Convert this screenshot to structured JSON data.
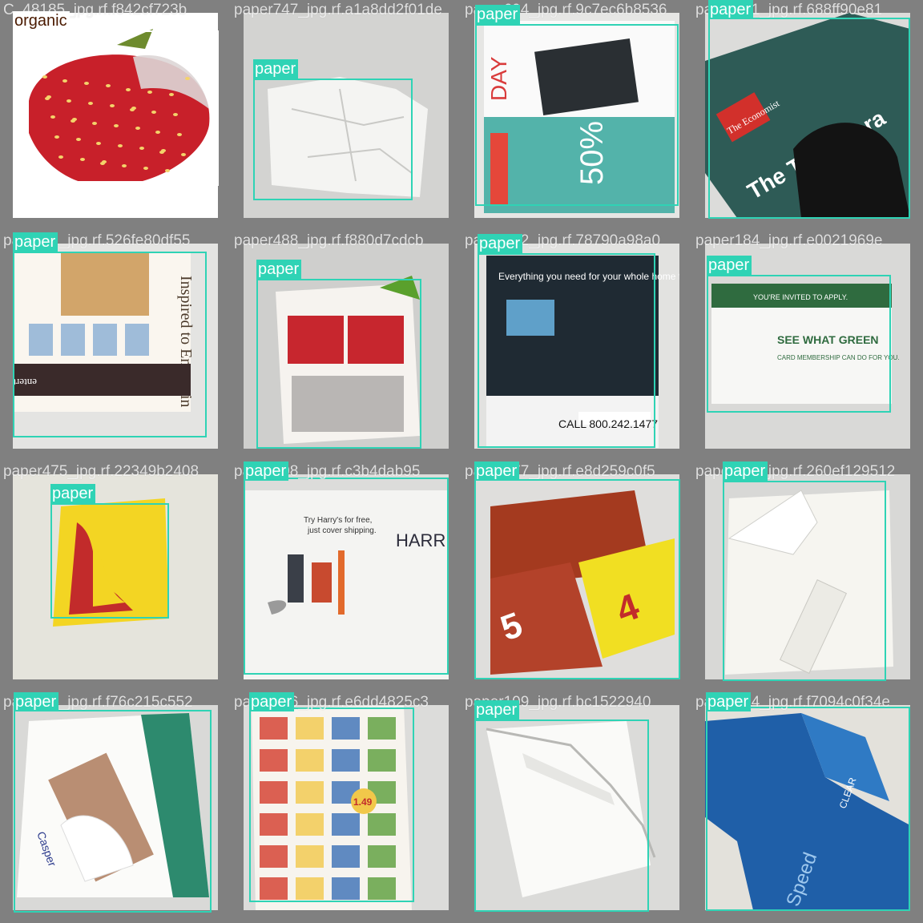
{
  "title": "",
  "label_colors": {
    "paper": "#2fd3b5",
    "organic": "#ffffff",
    "organic_text": "#4a1a00"
  },
  "tiles": [
    {
      "row": 0,
      "col": 0,
      "class": "organic",
      "label": "organic",
      "filenames": [
        "C_48185_jpg.rf.f842cf723b"
      ],
      "photo": "strawberry"
    },
    {
      "row": 0,
      "col": 1,
      "class": "paper",
      "label": "paper",
      "filenames": [
        "paper747_jpg.rf.a1a8dd2f01de"
      ],
      "photo": "crumpled-white"
    },
    {
      "row": 0,
      "col": 2,
      "class": "paper",
      "label": "paper",
      "filenames": [
        "paper694_jpg.rf.9c7ec6b8536"
      ],
      "photo": "dell-flyer"
    },
    {
      "row": 0,
      "col": 3,
      "class": "paper",
      "label": "paper",
      "filenames": [
        "paper431_jpg.rf.688ff90e81"
      ],
      "photo": "economist"
    },
    {
      "row": 1,
      "col": 0,
      "class": "paper",
      "label": "paper",
      "filenames": [
        "paper81_jpg.rf.526fe80df55"
      ],
      "photo": "entertain-ad"
    },
    {
      "row": 1,
      "col": 1,
      "class": "paper",
      "label": "paper",
      "filenames": [
        "paper488_jpg.rf.f880d7cdcb"
      ],
      "photo": "coupon-flyer"
    },
    {
      "row": 1,
      "col": 2,
      "class": "paper",
      "label": "paper",
      "filenames": [
        "paper172_jpg.rf.78790a98a0"
      ],
      "photo": "att-flyer"
    },
    {
      "row": 1,
      "col": 3,
      "class": "paper",
      "label": "paper",
      "filenames": [
        "paper184_jpg.rf.e0021969e"
      ],
      "photo": "green-envelope"
    },
    {
      "row": 2,
      "col": 0,
      "class": "paper",
      "label": "paper",
      "filenames": [
        "paper475_jpg.rf.22349b2408"
      ],
      "photo": "yellow-card"
    },
    {
      "row": 2,
      "col": 1,
      "class": "paper",
      "label": "paper",
      "filenames": [
        "paper108_jpg.rf.c3b4dab95"
      ],
      "photo": "harrys-mailer"
    },
    {
      "row": 2,
      "col": 2,
      "class": "paper",
      "label": "paper",
      "filenames": [
        "paper277_jpg.rf.e8d259c0f5"
      ],
      "photo": "pizza-flyer"
    },
    {
      "row": 2,
      "col": 3,
      "class": "paper",
      "label": "paper",
      "filenames": [
        "paper205_jpg.rf.260ef129512"
      ],
      "photo": "torn-envelope"
    },
    {
      "row": 3,
      "col": 0,
      "class": "paper",
      "label": "paper",
      "filenames": [
        "paper54_jpg.rf.f76c215c552"
      ],
      "photo": "catalog"
    },
    {
      "row": 3,
      "col": 1,
      "class": "paper",
      "label": "paper",
      "filenames": [
        "paper296_jpg.rf.e6dd4825c3"
      ],
      "photo": "grocery-flyer"
    },
    {
      "row": 3,
      "col": 2,
      "class": "paper",
      "label": "paper",
      "filenames": [
        "paper109_jpg.rf.bc1522940"
      ],
      "photo": "white-envelope"
    },
    {
      "row": 3,
      "col": 3,
      "class": "paper",
      "label": "paper",
      "filenames": [
        "paper234_jpg.rf.f7094c0f34e"
      ],
      "photo": "blue-mailer"
    }
  ],
  "photo_text": {
    "dell_day": "DAY",
    "dell_pct": "50%",
    "economist_brand": "The Economist",
    "economist_headline": "The Trump era",
    "entertain_script": "Inspired to Entertain",
    "entertain_banner": "entertaining MUST-HAVES",
    "att_headline": "Everything you need for your whole home from one provider.",
    "att_phone": "CALL 800.242.1477",
    "envelope_invite": "YOU'RE INVITED TO APPLY.",
    "envelope_main": "SEE WHAT GREEN",
    "envelope_sub": "CARD MEMBERSHIP CAN DO FOR YOU.",
    "harrys_brand": "HARR",
    "harrys_try": "Try Harry's for free,",
    "harrys_sub": "just cover shipping.",
    "pizza_price": "5",
    "pizza_slice": "4",
    "catalog_brand": "Casper",
    "grocery_badge": "1.49",
    "blue_brand": "CLEAR",
    "blue_script": "Speed"
  }
}
